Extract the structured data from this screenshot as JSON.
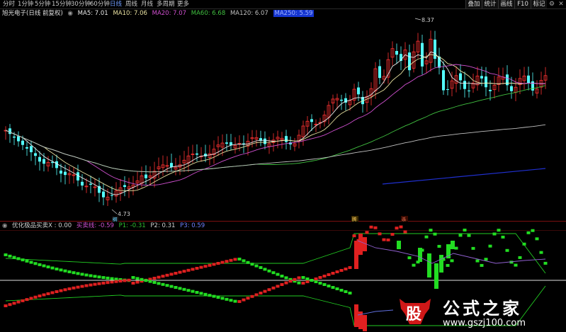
{
  "toolbar": {
    "periods": [
      "分时",
      "1分钟",
      "5分钟",
      "15分钟",
      "30分钟",
      "60分钟",
      "日线",
      "周线",
      "月线",
      "多周期",
      "更多"
    ],
    "active_period": "日线",
    "buttons": [
      "叠加",
      "统计",
      "画线",
      "F10",
      "标记"
    ],
    "settings_icon": "gear-icon",
    "close_icon": "close-icon"
  },
  "main_legend": {
    "stock": "旭光电子(日线 前复权)",
    "ma5": "MA5: 7.01",
    "ma10": "MA10: 7.06",
    "ma20": "MA20: 7.07",
    "ma60": "MA60: 6.68",
    "ma120": "MA120: 6.07",
    "ma250": "MA250: 5.59"
  },
  "price_annotations": {
    "high": "8.37",
    "low": "4.73",
    "mark_low": "纲",
    "mark_a": "腾",
    "mark_b": "杀"
  },
  "indicator_legend": {
    "name": "优化极品买卖X : 0.00",
    "buy_line": "买卖线: -0.59",
    "p1": "P1: -0.31",
    "p2": "P2: 0.31",
    "p3": "P3: 0.59"
  },
  "watermark": {
    "logo_char": "股",
    "title": "公式之家",
    "url": "www.gszj100.com"
  },
  "colors": {
    "up": "#ff3232",
    "down": "#54ffff",
    "ind_green": "#22dd22",
    "ind_red": "#e02020",
    "highlight": "#1535d0"
  }
}
